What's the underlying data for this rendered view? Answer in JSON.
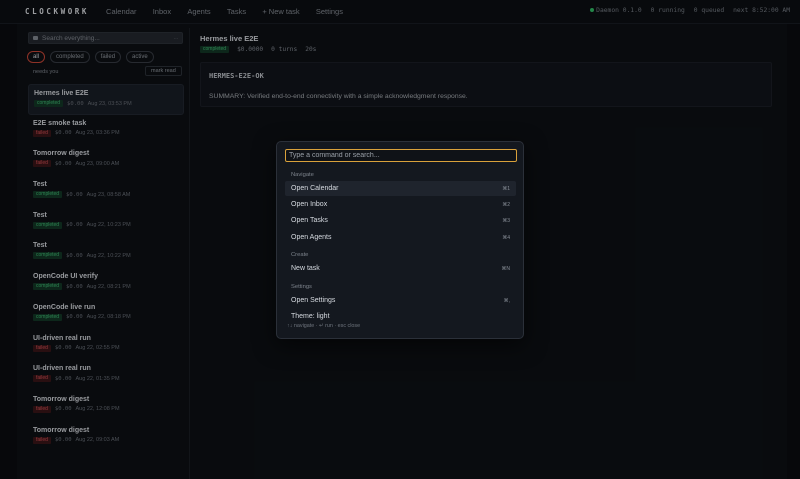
{
  "app": {
    "brand": "CLOCKWORK",
    "nav": [
      "Calendar",
      "Inbox",
      "Agents",
      "Tasks",
      "+ New task",
      "Settings"
    ],
    "status": {
      "daemon": "Daemon 0.1.0",
      "running": "0 running",
      "queued": "0 queued",
      "next": "next 8:52:00 AM"
    }
  },
  "sidebar": {
    "search_placeholder": "Search everything...",
    "search_shortcut": "...",
    "filters": [
      "all",
      "completed",
      "failed",
      "active"
    ],
    "needs_you": "needs you",
    "mark_read": "mark read",
    "tasks": [
      {
        "name": "Hermes live E2E",
        "status": "completed",
        "cost": "$0.00",
        "date": "Aug 23, 03:53 PM"
      },
      {
        "name": "E2E smoke task",
        "status": "failed",
        "cost": "$0.00",
        "date": "Aug 23, 03:36 PM"
      },
      {
        "name": "Tomorrow digest",
        "status": "failed",
        "cost": "$0.00",
        "date": "Aug 23, 09:00 AM"
      },
      {
        "name": "Test",
        "status": "completed",
        "cost": "$0.00",
        "date": "Aug 23, 08:58 AM"
      },
      {
        "name": "Test",
        "status": "completed",
        "cost": "$0.00",
        "date": "Aug 22, 10:23 PM"
      },
      {
        "name": "Test",
        "status": "completed",
        "cost": "$0.00",
        "date": "Aug 22, 10:22 PM"
      },
      {
        "name": "OpenCode UI verify",
        "status": "completed",
        "cost": "$0.00",
        "date": "Aug 22, 08:21 PM"
      },
      {
        "name": "OpenCode live run",
        "status": "completed",
        "cost": "$0.00",
        "date": "Aug 22, 08:18 PM"
      },
      {
        "name": "UI-driven real run",
        "status": "failed",
        "cost": "$0.00",
        "date": "Aug 22, 02:55 PM"
      },
      {
        "name": "UI-driven real run",
        "status": "failed",
        "cost": "$0.00",
        "date": "Aug 22, 01:35 PM"
      },
      {
        "name": "Tomorrow digest",
        "status": "failed",
        "cost": "$0.00",
        "date": "Aug 22, 12:08 PM"
      },
      {
        "name": "Tomorrow digest",
        "status": "failed",
        "cost": "$0.00",
        "date": "Aug 22, 09:03 AM"
      }
    ]
  },
  "detail": {
    "title": "Hermes live E2E",
    "status": "completed",
    "cost": "$0.0000",
    "turns": "0 turns",
    "duration": "20s",
    "heading": "HERMES-E2E-OK",
    "summary": "SUMMARY: Verified end-to-end connectivity with a simple acknowledgment response."
  },
  "palette": {
    "placeholder": "Type a command or search...",
    "groups": [
      {
        "label": "Navigate",
        "items": [
          {
            "label": "Open Calendar",
            "shortcut": "⌘1"
          },
          {
            "label": "Open Inbox",
            "shortcut": "⌘2"
          },
          {
            "label": "Open Tasks",
            "shortcut": "⌘3"
          },
          {
            "label": "Open Agents",
            "shortcut": "⌘4"
          }
        ]
      },
      {
        "label": "Create",
        "items": [
          {
            "label": "New task",
            "shortcut": "⌘N"
          }
        ]
      },
      {
        "label": "Settings",
        "items": [
          {
            "label": "Open Settings",
            "shortcut": "⌘,"
          },
          {
            "label": "Theme: light",
            "shortcut": ""
          }
        ]
      }
    ],
    "footer": "↑↓ navigate · ↵ run · esc close"
  }
}
